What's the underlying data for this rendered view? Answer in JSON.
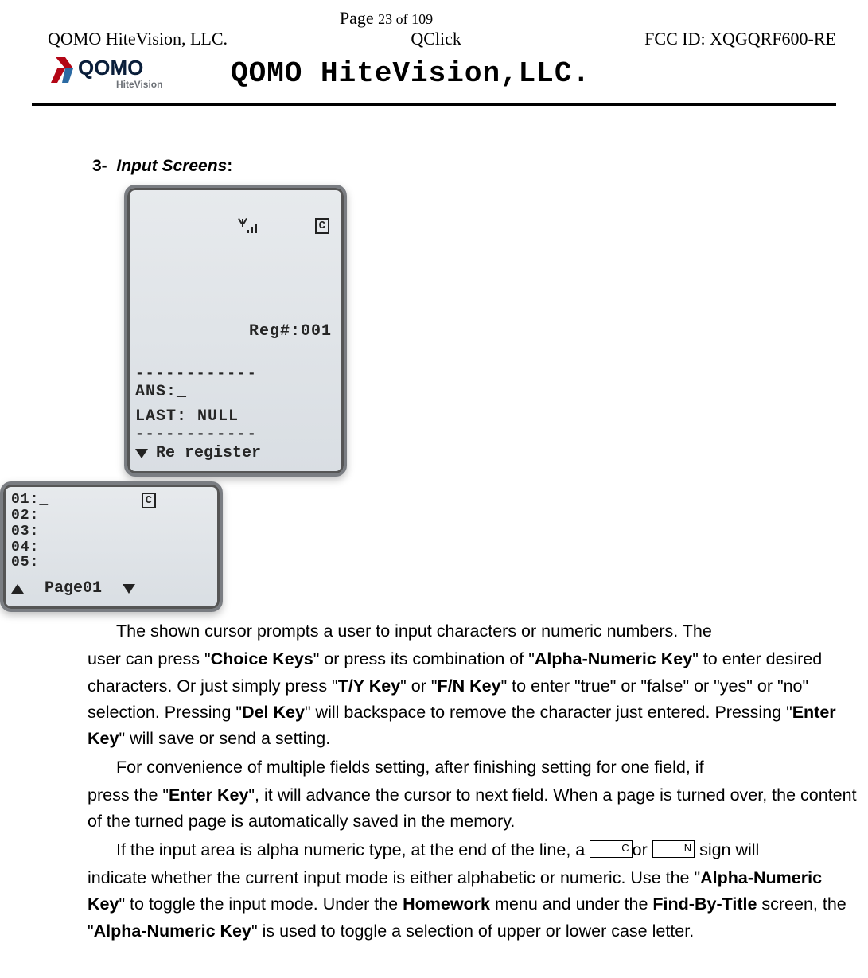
{
  "header": {
    "page_label_prefix": "Page ",
    "page_current": "23",
    "page_of": " of ",
    "page_total": "109",
    "left": "QOMO HiteVision, LLC.",
    "center": "QClick",
    "right": "FCC ID: XQGQRF600-RE",
    "company_title": "QOMO HiteVision,LLC.",
    "logo_sub": "HiteVision"
  },
  "section": {
    "number": "3-",
    "title_italic": "Input Screens",
    "title_colon": ":"
  },
  "lcd1": {
    "reg_line": "Reg#:001",
    "dashes": "------------",
    "ans_line": "ANS:_",
    "last_line": "LAST: NULL",
    "bottom_label": "Re_register",
    "mode_box": "C"
  },
  "lcd2": {
    "rows": [
      "01:_",
      "02:",
      "03:",
      "04:",
      "05:"
    ],
    "page_label": "Page01",
    "mode_box": "C"
  },
  "para1": {
    "t1": "The shown cursor prompts a user to input characters or numeric numbers. The ",
    "t2": "user can press \"",
    "b1": "Choice Keys",
    "t3": "\" or press its combination of \"",
    "b2": "Alpha-Numeric Key",
    "t4": "\" to ",
    "t5": "enter desired characters. Or just simply press \"",
    "b3": "T/Y Key",
    "t6": "\" or \"",
    "b4": "F/N Key",
    "t7": "\" to enter \"true\" ",
    "t8": "or \"false\" or \"yes\" or \"no\" selection. Pressing \"",
    "b5": "Del Key",
    "t9": "\" will backspace to remove the ",
    "t10": "character just entered. Pressing \"",
    "b6": "Enter Key",
    "t11": "\" will save or send a setting."
  },
  "para2": {
    "t1": "For convenience of multiple fields setting, after finishing setting for one field, if ",
    "t2": "press the \"",
    "b1": "Enter Key",
    "t3": "\", it will advance the cursor to next field. When a page is turned ",
    "t4": "over, the content of the turned page is automatically saved in the memory."
  },
  "para3": {
    "t1": "If the input area is alpha numeric type, at the end of the line, a ",
    "box_c": "C",
    "t2": "or ",
    "box_n": "N",
    "t3": " sign will ",
    "t4": "indicate whether the current input mode is either alphabetic or numeric. Use the ",
    "t5": "\"",
    "b1": "Alpha-Numeric Key",
    "t6": "\" to toggle the input mode. Under the ",
    "b2": "Homework",
    "t7": " menu and ",
    "t8": "under the ",
    "b3": "Find-By-Title",
    "t9": " screen, the \"",
    "b4": "Alpha-Numeric Key",
    "t10": "\" is used to toggle a ",
    "t11": "selection of upper or lower case letter."
  }
}
